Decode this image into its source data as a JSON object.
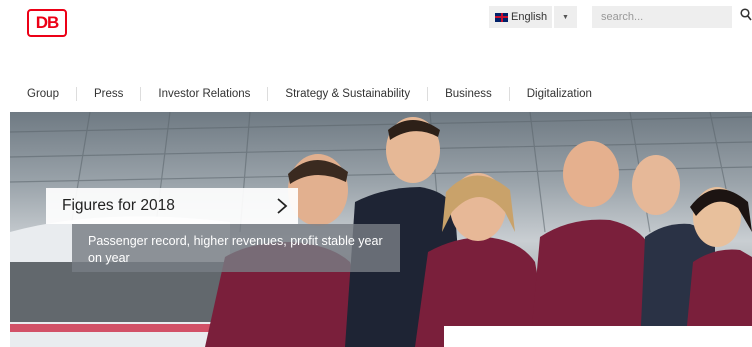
{
  "header": {
    "logo_text": "DB",
    "language": {
      "label": "English",
      "flag": "uk-flag-icon"
    },
    "search": {
      "placeholder": "search..."
    }
  },
  "nav": {
    "items": [
      "Group",
      "Press",
      "Investor Relations",
      "Strategy & Sustainability",
      "Business",
      "Digitalization"
    ]
  },
  "hero": {
    "title": "Figures for 2018",
    "subtitle": "Passenger record, higher revenues, profit stable year on year"
  },
  "colors": {
    "brand_red": "#ec0016",
    "uniform": "#7a1f3b",
    "nav_text": "#333333"
  }
}
